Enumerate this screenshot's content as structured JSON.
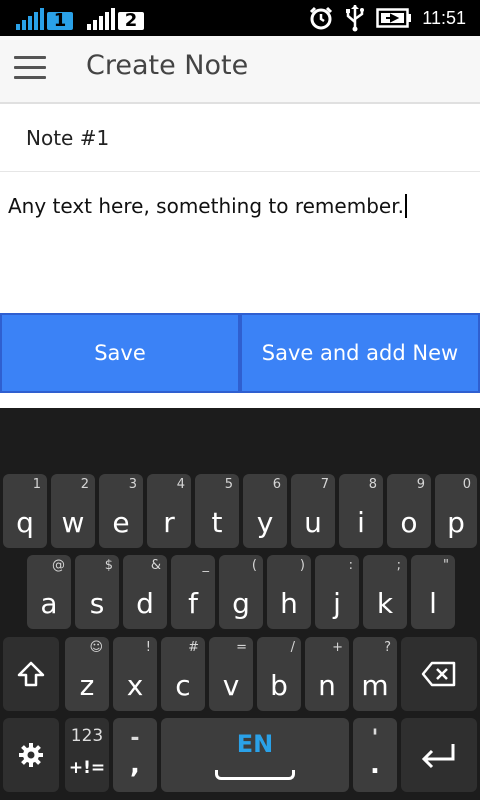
{
  "status_bar": {
    "sim1_label": "1",
    "sim2_label": "2",
    "time": "11:51",
    "icons": [
      "signal-icon",
      "alarm-icon",
      "usb-icon",
      "battery-charging-icon"
    ]
  },
  "app_bar": {
    "title": "Create Note",
    "menu_icon": "hamburger-menu-icon"
  },
  "note": {
    "title_value": "Note #1",
    "body_value": "Any text here, something to remember."
  },
  "buttons": {
    "save_label": "Save",
    "save_new_label": "Save and add New"
  },
  "keyboard": {
    "row1": [
      {
        "key": "q",
        "hint": "1"
      },
      {
        "key": "w",
        "hint": "2"
      },
      {
        "key": "e",
        "hint": "3"
      },
      {
        "key": "r",
        "hint": "4"
      },
      {
        "key": "t",
        "hint": "5"
      },
      {
        "key": "y",
        "hint": "6"
      },
      {
        "key": "u",
        "hint": "7"
      },
      {
        "key": "i",
        "hint": "8"
      },
      {
        "key": "o",
        "hint": "9"
      },
      {
        "key": "p",
        "hint": "0"
      }
    ],
    "row2": [
      {
        "key": "a",
        "hint": "@"
      },
      {
        "key": "s",
        "hint": "$"
      },
      {
        "key": "d",
        "hint": "&"
      },
      {
        "key": "f",
        "hint": "_"
      },
      {
        "key": "g",
        "hint": "("
      },
      {
        "key": "h",
        "hint": ")"
      },
      {
        "key": "j",
        "hint": ":"
      },
      {
        "key": "k",
        "hint": ";"
      },
      {
        "key": "l",
        "hint": "\""
      }
    ],
    "row3": [
      {
        "key": "z",
        "hint": "☺"
      },
      {
        "key": "x",
        "hint": "!"
      },
      {
        "key": "c",
        "hint": "#"
      },
      {
        "key": "v",
        "hint": "="
      },
      {
        "key": "b",
        "hint": "/"
      },
      {
        "key": "n",
        "hint": "+"
      },
      {
        "key": "m",
        "hint": "?"
      }
    ],
    "symbols_top": "123",
    "symbols_bottom": "+!=",
    "dash_top": "-",
    "dash_bottom": ",",
    "language": "EN",
    "period_top": "'",
    "period_bottom": ".",
    "accent_color": "#2aa1e8"
  }
}
